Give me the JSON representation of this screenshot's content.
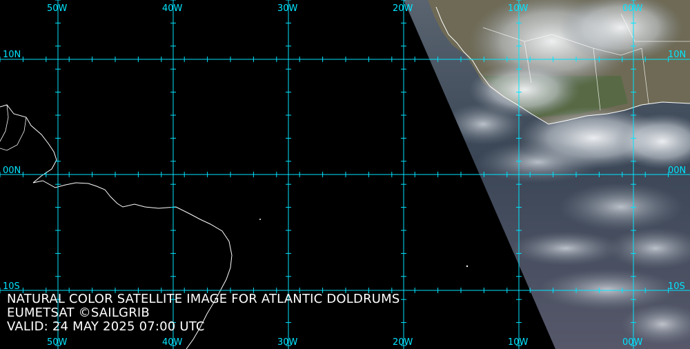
{
  "caption": {
    "line1": "NATURAL COLOR SATELLITE IMAGE FOR ATLANTIC DOLDRUMS",
    "line2": "EUMETSAT ©SAILGRIB",
    "line3": "VALID:  24 MAY 2025 07:00 UTC"
  },
  "longitude_labels_top": [
    "50W",
    "40W",
    "30W",
    "20W",
    "10W",
    "00W"
  ],
  "longitude_labels_bottom": [
    "50W",
    "40W",
    "30W",
    "20W",
    "10W",
    "00W"
  ],
  "latitude_labels_left": [
    "10N",
    "00N",
    "10S"
  ],
  "latitude_labels_right": [
    "10N",
    "00N",
    "10S"
  ],
  "colors": {
    "grid": "#00e5ff",
    "coastline": "#ffffff",
    "background": "#000000"
  }
}
